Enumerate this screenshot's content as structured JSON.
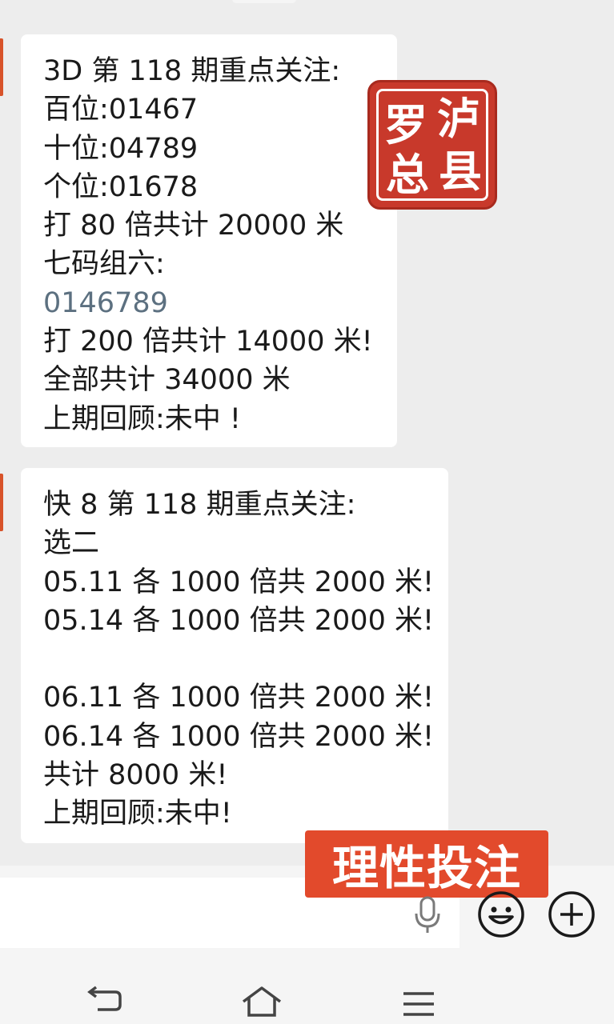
{
  "messages": [
    {
      "lines": [
        "3D 第 118 期重点关注:",
        "百位:01467",
        "十位:04789",
        "个位:01678",
        "打 80 倍共计 20000 米",
        "七码组六:",
        "0146789",
        "打 200 倍共计 14000 米!",
        "全部共计 34000 米",
        "上期回顾:未中 !"
      ]
    },
    {
      "lines": [
        "快 8 第 118 期重点关注:",
        "选二",
        "05.11 各 1000 倍共 2000 米!",
        "05.14 各 1000 倍共 2000 米!",
        "",
        "06.11 各 1000 倍共 2000 米!",
        "06.14 各 1000 倍共 2000 米!",
        "共计 8000 米!",
        "上期回顾:未中!"
      ]
    }
  ],
  "seal": {
    "chars": [
      "泸",
      "罗",
      "县",
      "总"
    ],
    "color": "#c8392b"
  },
  "stamp": {
    "text": "理性投注",
    "color": "#e24a2c"
  },
  "input_bar": {
    "icons": [
      "microphone-icon",
      "emoji-icon",
      "plus-icon"
    ]
  },
  "nav_bar": {
    "icons": [
      "back-icon",
      "home-icon",
      "menu-icon"
    ]
  },
  "colors": {
    "background": "#ededed",
    "bubble": "#ffffff",
    "link_number": "#5c7080"
  }
}
